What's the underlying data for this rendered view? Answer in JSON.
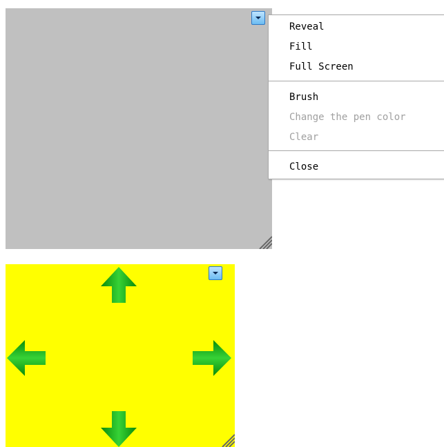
{
  "context_menu": {
    "items": [
      {
        "label": "Reveal",
        "enabled": true
      },
      {
        "label": "Fill",
        "enabled": true
      },
      {
        "label": "Full Screen",
        "enabled": true
      },
      {
        "label": "Brush",
        "enabled": true
      },
      {
        "label": "Change the pen color",
        "enabled": false
      },
      {
        "label": "Clear",
        "enabled": false
      },
      {
        "label": "Close",
        "enabled": true
      }
    ]
  },
  "panels": {
    "gray": {
      "background": "#c0c0c0"
    },
    "yellow": {
      "background": "#ffff00"
    }
  },
  "arrows": {
    "color": "#1faa1f",
    "icons": [
      "arrow-up-icon",
      "arrow-down-icon",
      "arrow-left-icon",
      "arrow-right-icon"
    ]
  }
}
